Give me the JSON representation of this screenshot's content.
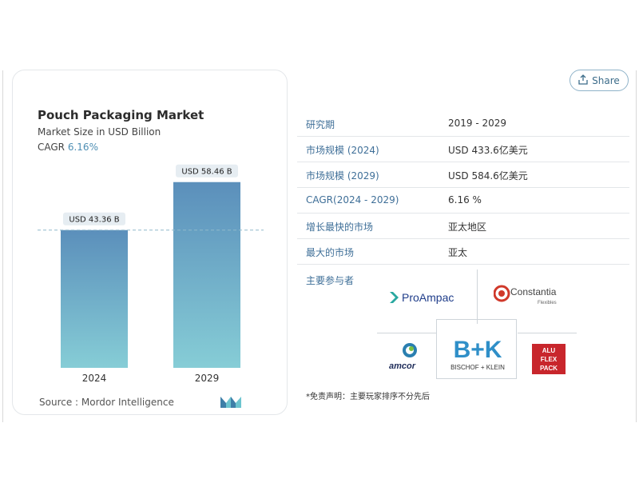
{
  "chart_data": {
    "type": "bar",
    "title": "Pouch Packaging Market",
    "subtitle": "Market Size in USD Billion",
    "cagr_label": "CAGR",
    "cagr_value": "6.16%",
    "categories": [
      "2024",
      "2029"
    ],
    "values": [
      43.36,
      58.46
    ],
    "value_labels": [
      "USD 43.36 B",
      "USD 58.46 B"
    ],
    "ylim": [
      0,
      75
    ],
    "grid": false,
    "colors": {
      "bar_top": "#5b8fbb",
      "bar_bottom": "#86cdd6",
      "label_bg": "#e6edf2",
      "ref_line": "#8fb9cc"
    }
  },
  "source": "Source :  Mordor Intelligence",
  "share_label": "Share",
  "info_rows": [
    {
      "key": "研究期",
      "value": "2019 - 2029"
    },
    {
      "key": "市场规模 (2024)",
      "value": "USD 433.6亿美元"
    },
    {
      "key": "市场规模 (2029)",
      "value": "USD 584.6亿美元"
    },
    {
      "key": "CAGR(2024 - 2029)",
      "value": "6.16 %"
    },
    {
      "key": "增长最快的市场",
      "value": "亚太地区"
    },
    {
      "key": "最大的市场",
      "value": "亚太"
    }
  ],
  "players_label": "主要参与者",
  "players": {
    "proampac": "ProAmpac",
    "constantia": "Constantia",
    "constantia_sub": "Flexibles",
    "amcor": "amcor",
    "bk_mark": "B+K",
    "bk_name": "BISCHOF + KLEIN",
    "aluflex": [
      "ALU",
      "FLEX",
      "PACK"
    ]
  },
  "disclaimer": "*免责声明：主要玩家排序不分先后",
  "icons": {
    "share": "share-icon",
    "brand": "mordor-logo-icon"
  }
}
